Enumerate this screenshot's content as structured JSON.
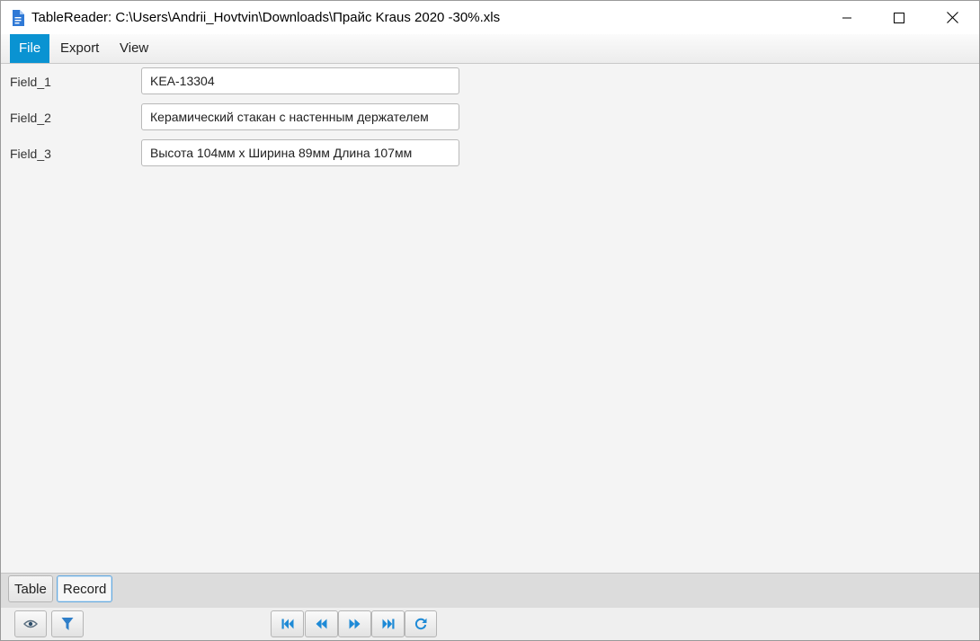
{
  "window": {
    "title": "TableReader: C:\\Users\\Andrii_Hovtvin\\Downloads\\Прайс Kraus 2020 -30%.xls",
    "app_icon": "document-icon",
    "controls": [
      "minimize-icon",
      "maximize-icon",
      "close-icon"
    ]
  },
  "menu": {
    "items": [
      {
        "label": "File",
        "active": true
      },
      {
        "label": "Export",
        "active": false
      },
      {
        "label": "View",
        "active": false
      }
    ]
  },
  "record": {
    "fields": [
      {
        "label": "Field_1",
        "value": "KEA-13304"
      },
      {
        "label": "Field_2",
        "value": "Керамический стакан с настенным держателем"
      },
      {
        "label": "Field_3",
        "value": "Высота 104мм x Ширина 89мм Длина 107мм"
      }
    ]
  },
  "tabs": [
    {
      "label": "Table",
      "selected": false
    },
    {
      "label": "Record",
      "selected": true
    }
  ],
  "toolbar": {
    "left_buttons": [
      "eye-icon",
      "filter-icon"
    ],
    "nav_buttons": [
      "first-record-icon",
      "previous-record-icon",
      "next-record-icon",
      "last-record-icon",
      "refresh-icon"
    ]
  },
  "colors": {
    "accent": "#0a93d2",
    "icon_blue": "#1e8ad6"
  }
}
